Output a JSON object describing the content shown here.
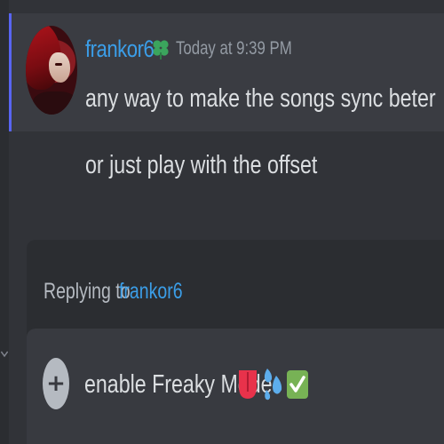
{
  "message": {
    "author": "frankor6",
    "author_badge_icon": "clover-icon",
    "timestamp": "Today at 9:39 PM",
    "lines": [
      "any way to make the songs sync beter",
      "or just play with the offset"
    ],
    "highlight_accent": "#5865f2",
    "username_color": "#3b9ee8"
  },
  "composer": {
    "reply": {
      "label": "Replying to",
      "target": "frankor6"
    },
    "input_value": "enable Freaky Mode",
    "emojis": [
      "tongue-emoji",
      "sweat-droplets-emoji",
      "check-mark-button-emoji"
    ],
    "add_icon": "plus-circle-icon"
  },
  "sidebar": {
    "collapse_icon": "chevron-down-icon"
  }
}
